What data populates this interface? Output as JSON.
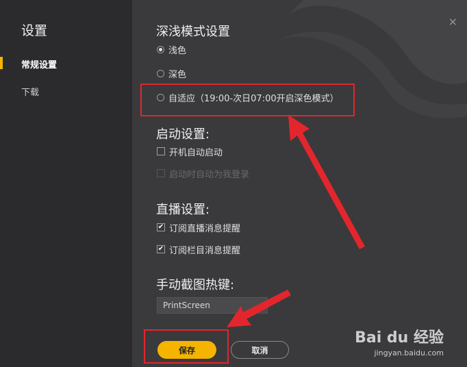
{
  "sidebar": {
    "title": "设置",
    "items": [
      {
        "label": "常规设置",
        "active": true
      },
      {
        "label": "下载",
        "active": false
      }
    ]
  },
  "window": {
    "close_symbol": "×"
  },
  "theme": {
    "title": "深浅模式设置",
    "options": [
      {
        "label": "浅色",
        "checked": true
      },
      {
        "label": "深色",
        "checked": false
      },
      {
        "label": "自适应（19:00-次日07:00开启深色模式）",
        "checked": false
      }
    ]
  },
  "startup": {
    "title": "启动设置:",
    "options": [
      {
        "label": "开机自动启动",
        "checked": false,
        "disabled": false
      },
      {
        "label": "启动时自动为我登录",
        "checked": false,
        "disabled": true
      }
    ]
  },
  "live": {
    "title": "直播设置:",
    "options": [
      {
        "label": "订阅直播消息提醒",
        "checked": true
      },
      {
        "label": "订阅栏目消息提醒",
        "checked": true
      }
    ]
  },
  "screenshot": {
    "title": "手动截图热键:",
    "hotkey_value": "PrintScreen"
  },
  "buttons": {
    "save": "保存",
    "cancel": "取消"
  },
  "watermark": {
    "logo": "Bai du 经验",
    "url": "jingyan.baidu.com"
  },
  "colors": {
    "accent": "#f5b400",
    "annotation": "#e3262d",
    "background": "#3a3a3c",
    "sidebar": "#2b2b2d"
  }
}
